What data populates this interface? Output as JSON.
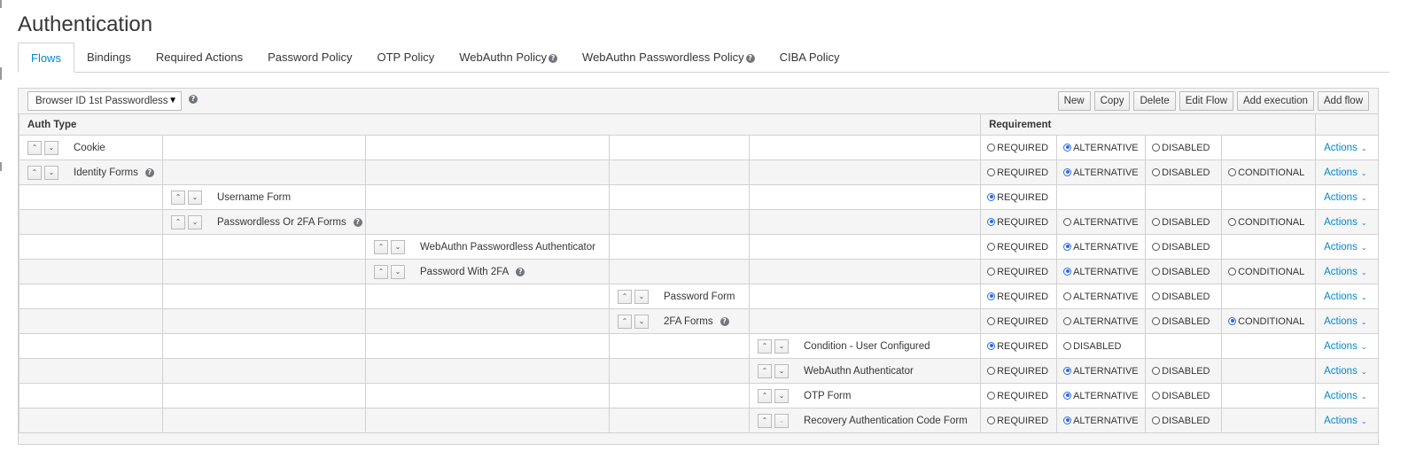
{
  "page": {
    "title": "Authentication"
  },
  "tabs": [
    {
      "label": "Flows",
      "active": true,
      "help": false
    },
    {
      "label": "Bindings",
      "help": false
    },
    {
      "label": "Required Actions",
      "help": false
    },
    {
      "label": "Password Policy",
      "help": false
    },
    {
      "label": "OTP Policy",
      "help": false
    },
    {
      "label": "WebAuthn Policy",
      "help": true
    },
    {
      "label": "WebAuthn Passwordless Policy",
      "help": true
    },
    {
      "label": "CIBA Policy",
      "help": false
    }
  ],
  "toolbar": {
    "flow_select_value": "Browser ID 1st Passwordless",
    "buttons": [
      "New",
      "Copy",
      "Delete",
      "Edit Flow",
      "Add execution",
      "Add flow"
    ]
  },
  "table": {
    "headers": {
      "auth_type": "Auth Type",
      "requirement": "Requirement"
    },
    "actions_label": "Actions",
    "rows": [
      {
        "level": 0,
        "name": "Cookie",
        "help": false,
        "options": [
          [
            "REQUIRED",
            false
          ],
          [
            "ALTERNATIVE",
            true
          ],
          [
            "DISABLED",
            false
          ]
        ]
      },
      {
        "level": 0,
        "name": "Identity Forms",
        "help": true,
        "options": [
          [
            "REQUIRED",
            false
          ],
          [
            "ALTERNATIVE",
            true
          ],
          [
            "DISABLED",
            false
          ],
          [
            "CONDITIONAL",
            false
          ]
        ]
      },
      {
        "level": 1,
        "name": "Username Form",
        "help": false,
        "options": [
          [
            "REQUIRED",
            true
          ]
        ]
      },
      {
        "level": 1,
        "name": "Passwordless Or 2FA Forms",
        "help": true,
        "options": [
          [
            "REQUIRED",
            true
          ],
          [
            "ALTERNATIVE",
            false
          ],
          [
            "DISABLED",
            false
          ],
          [
            "CONDITIONAL",
            false
          ]
        ]
      },
      {
        "level": 2,
        "name": "WebAuthn Passwordless Authenticator",
        "help": false,
        "options": [
          [
            "REQUIRED",
            false
          ],
          [
            "ALTERNATIVE",
            true
          ],
          [
            "DISABLED",
            false
          ]
        ]
      },
      {
        "level": 2,
        "name": "Password With 2FA",
        "help": true,
        "options": [
          [
            "REQUIRED",
            false
          ],
          [
            "ALTERNATIVE",
            true
          ],
          [
            "DISABLED",
            false
          ],
          [
            "CONDITIONAL",
            false
          ]
        ]
      },
      {
        "level": 3,
        "name": "Password Form",
        "help": false,
        "options": [
          [
            "REQUIRED",
            true
          ],
          [
            "ALTERNATIVE",
            false
          ],
          [
            "DISABLED",
            false
          ]
        ]
      },
      {
        "level": 3,
        "name": "2FA Forms",
        "help": true,
        "options": [
          [
            "REQUIRED",
            false
          ],
          [
            "ALTERNATIVE",
            false
          ],
          [
            "DISABLED",
            false
          ],
          [
            "CONDITIONAL",
            true
          ]
        ]
      },
      {
        "level": 4,
        "name": "Condition - User Configured",
        "help": false,
        "options": [
          [
            "REQUIRED",
            true
          ],
          [
            "DISABLED",
            false
          ]
        ]
      },
      {
        "level": 4,
        "name": "WebAuthn Authenticator",
        "help": false,
        "options": [
          [
            "REQUIRED",
            false
          ],
          [
            "ALTERNATIVE",
            true
          ],
          [
            "DISABLED",
            false
          ]
        ]
      },
      {
        "level": 4,
        "name": "OTP Form",
        "help": false,
        "options": [
          [
            "REQUIRED",
            false
          ],
          [
            "ALTERNATIVE",
            true
          ],
          [
            "DISABLED",
            false
          ]
        ]
      },
      {
        "level": 4,
        "name": "Recovery Authentication Code Form",
        "help": false,
        "down_disabled": true,
        "options": [
          [
            "REQUIRED",
            false
          ],
          [
            "ALTERNATIVE",
            true
          ],
          [
            "DISABLED",
            false
          ]
        ]
      }
    ]
  }
}
